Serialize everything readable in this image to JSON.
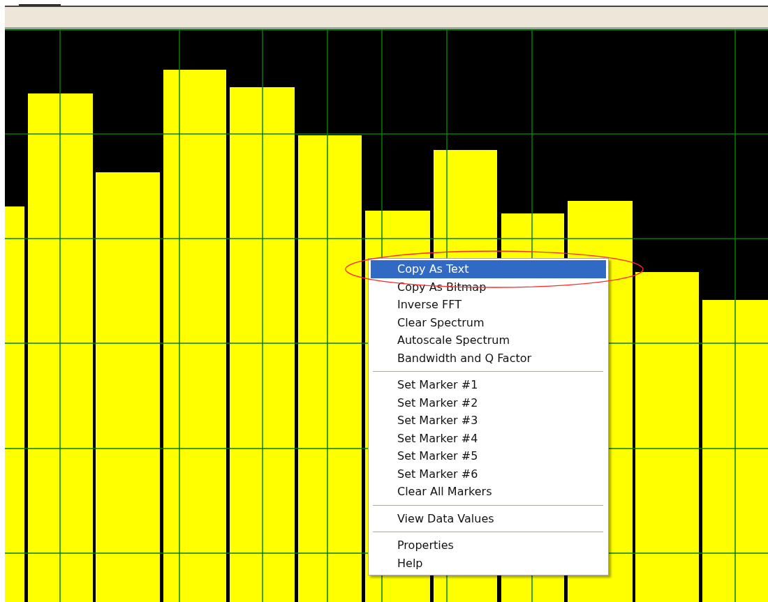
{
  "context_menu": {
    "items": [
      {
        "kind": "item",
        "label": "Copy As Text",
        "selected": true
      },
      {
        "kind": "item",
        "label": "Copy As Bitmap",
        "selected": false
      },
      {
        "kind": "item",
        "label": "Inverse FFT",
        "selected": false
      },
      {
        "kind": "item",
        "label": "Clear Spectrum",
        "selected": false
      },
      {
        "kind": "item",
        "label": "Autoscale Spectrum",
        "selected": false
      },
      {
        "kind": "item",
        "label": "Bandwidth and Q Factor",
        "selected": false
      },
      {
        "kind": "separator"
      },
      {
        "kind": "item",
        "label": "Set Marker #1",
        "selected": false
      },
      {
        "kind": "item",
        "label": "Set Marker #2",
        "selected": false
      },
      {
        "kind": "item",
        "label": "Set Marker #3",
        "selected": false
      },
      {
        "kind": "item",
        "label": "Set Marker #4",
        "selected": false
      },
      {
        "kind": "item",
        "label": "Set Marker #5",
        "selected": false
      },
      {
        "kind": "item",
        "label": "Set Marker #6",
        "selected": false
      },
      {
        "kind": "item",
        "label": "Clear All Markers",
        "selected": false
      },
      {
        "kind": "separator"
      },
      {
        "kind": "item",
        "label": "View Data Values",
        "selected": false
      },
      {
        "kind": "separator"
      },
      {
        "kind": "item",
        "label": "Properties",
        "selected": false
      },
      {
        "kind": "item",
        "label": "Help",
        "selected": false
      }
    ]
  }
}
